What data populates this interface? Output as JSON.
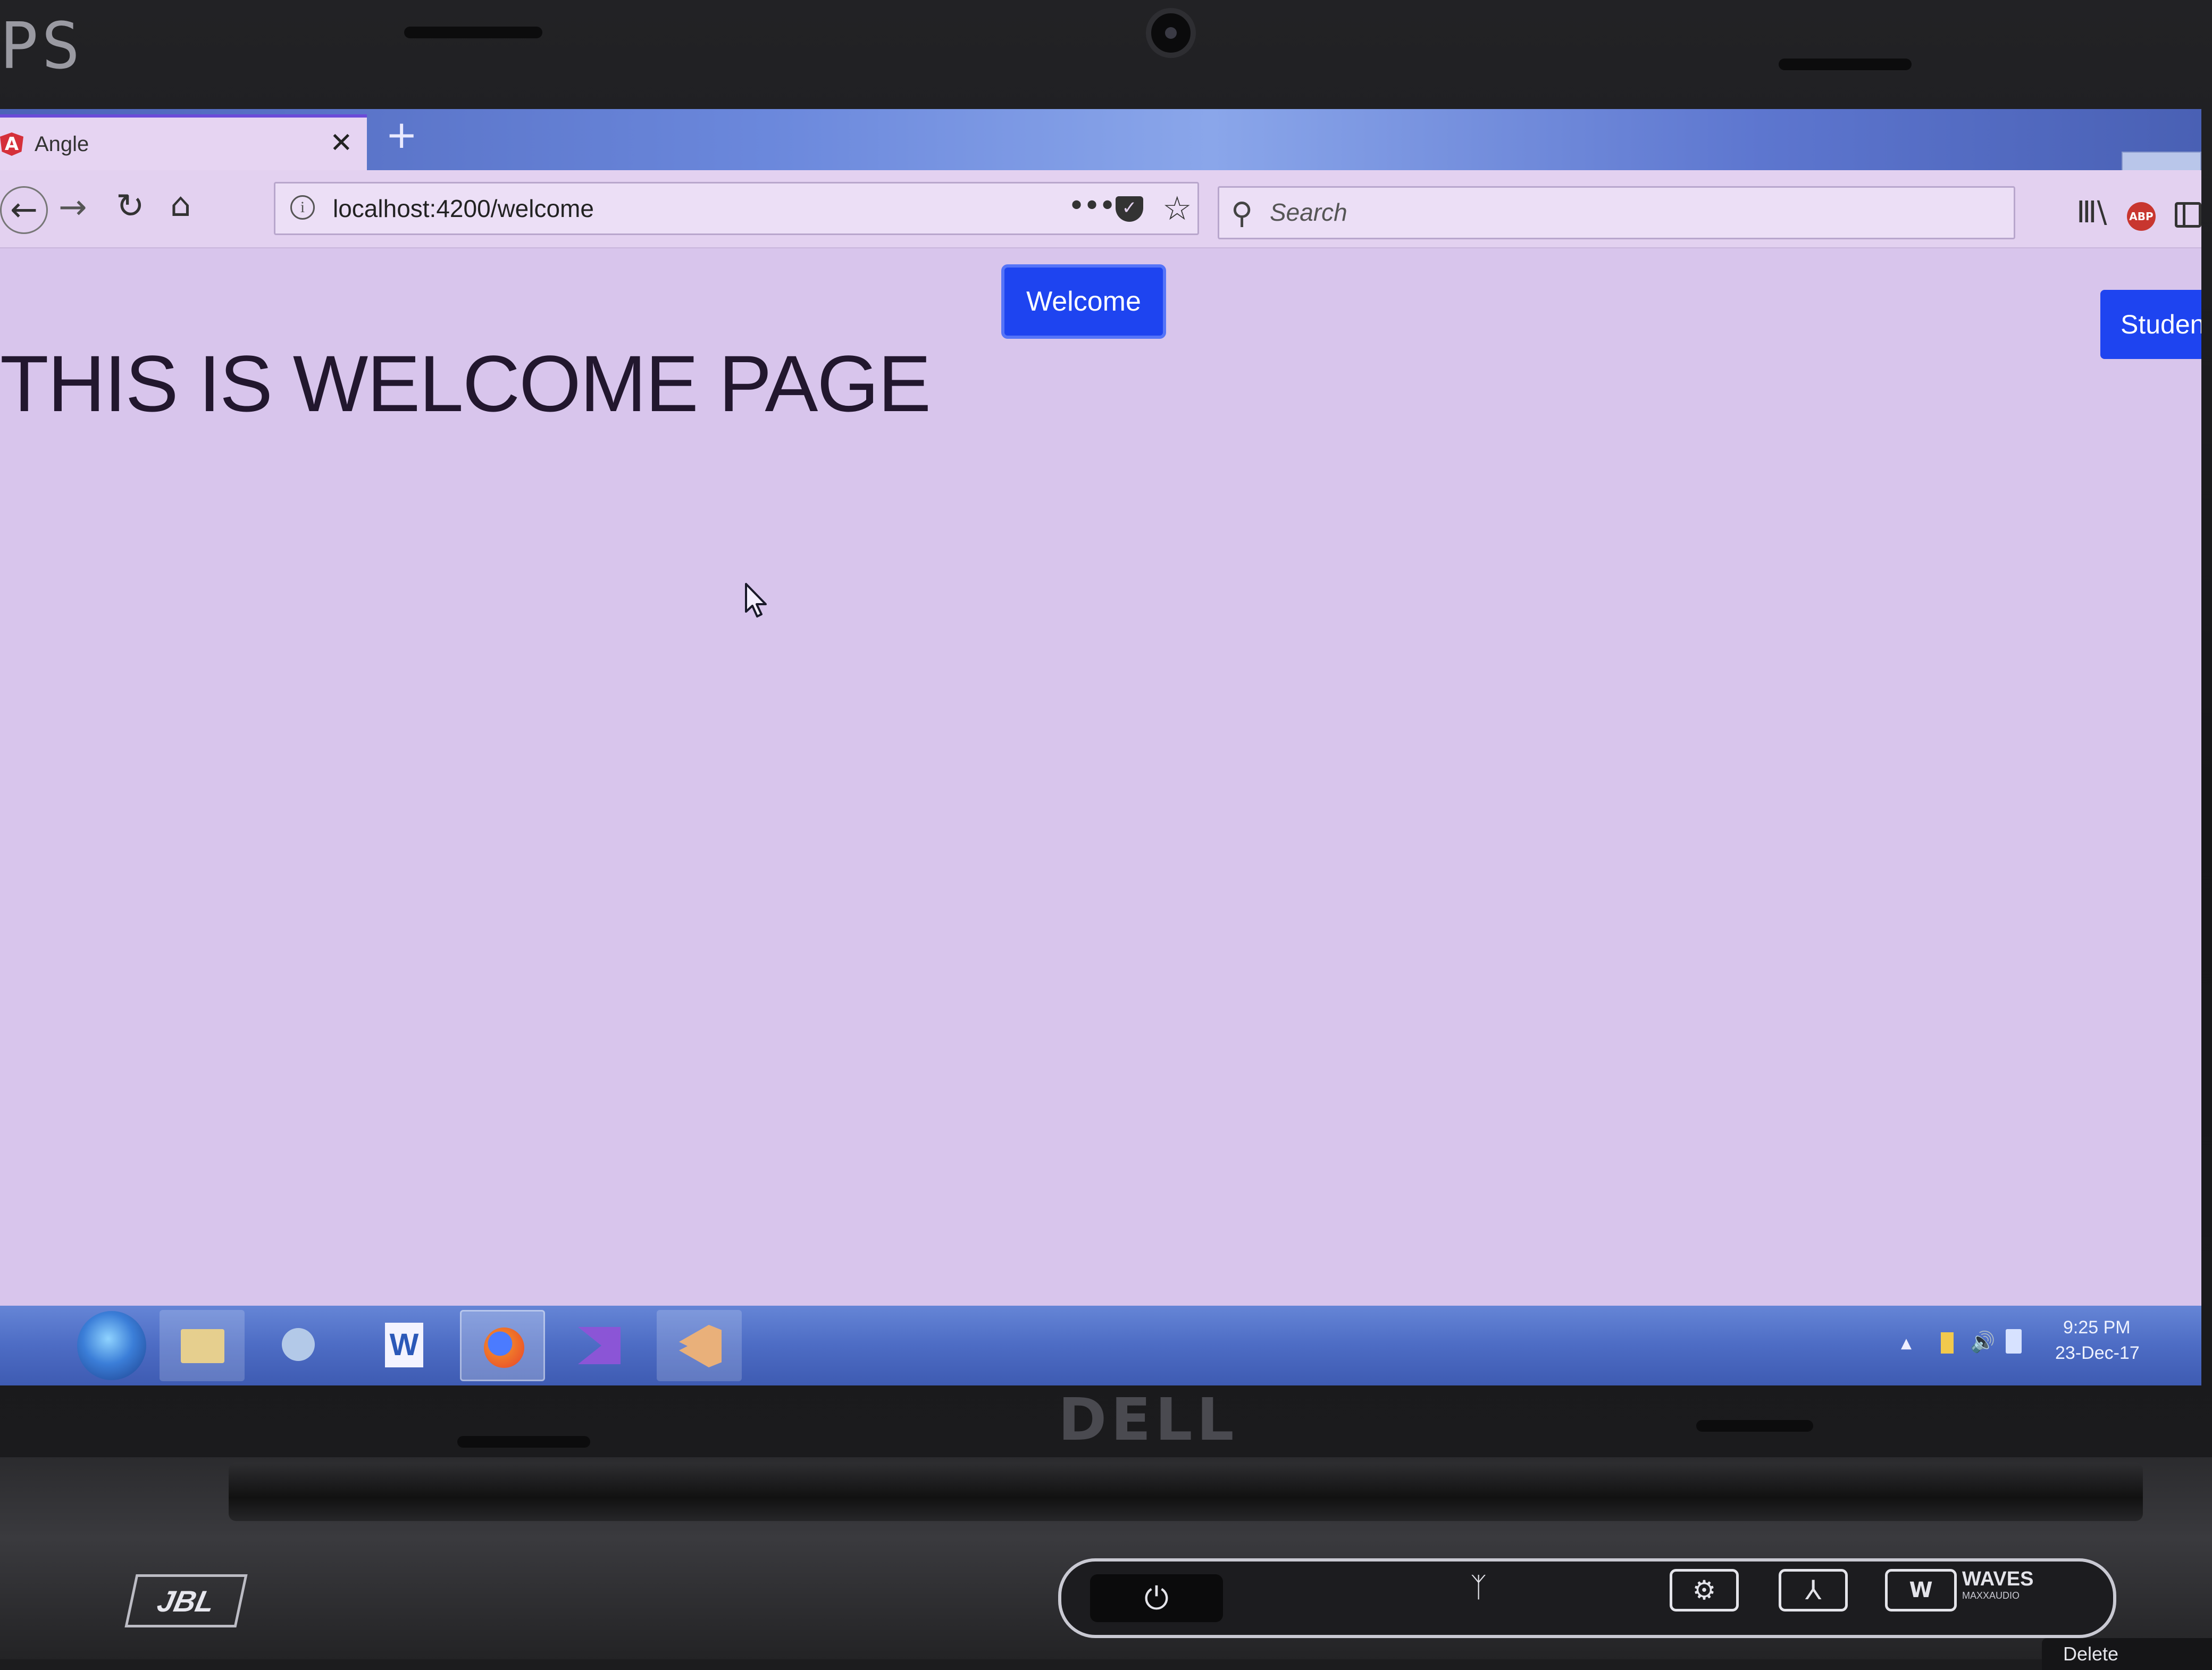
{
  "device": {
    "bezel_text": "PS",
    "brand": "DELL",
    "speaker_brand": "JBL",
    "audio_brand": "WAVES",
    "audio_brand_sub": "MAXXAUDIO",
    "delete_key_label": "Delete"
  },
  "browser": {
    "tab": {
      "title": "Angle",
      "close_symbol": "✕"
    },
    "new_tab_symbol": "+",
    "nav": {
      "back": "←",
      "forward": "→",
      "reload": "↻",
      "home": "⌂"
    },
    "url": {
      "info_symbol": "i",
      "value": "localhost:4200/welcome"
    },
    "page_actions": "•••",
    "pocket_symbol": "✓",
    "bookmark_symbol": "☆",
    "search": {
      "icon": "⚲",
      "placeholder": "Search"
    },
    "toolbar": {
      "library_symbol": "Ⅲ\\",
      "adblock_label": "ABP"
    }
  },
  "page": {
    "welcome_button": "Welcome",
    "student_button": "Student",
    "heading": "THIS IS WELCOME PAGE"
  },
  "taskbar": {
    "tray_arrow": "▲",
    "tray_volume": "🔊",
    "time": "9:25 PM",
    "date": "23-Dec-17"
  },
  "deck": {
    "power_symbol": "⏻",
    "wireless_symbol": "ᛉ",
    "settings_symbol": "⚙",
    "network_symbol": "⅄",
    "waves_symbol": "W"
  },
  "colors": {
    "accent_button": "#1e44f0",
    "screen_tint": "#d8c5ec",
    "taskbar": "#4d6cc4"
  }
}
